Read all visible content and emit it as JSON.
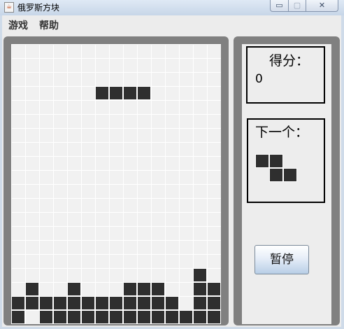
{
  "window": {
    "title": "俄罗斯方块",
    "minimize_glyph": "▭",
    "maximize_glyph": "▢",
    "close_glyph": "✕"
  },
  "menu": {
    "items": [
      "游戏",
      "帮助"
    ]
  },
  "score": {
    "label": "得分：",
    "value": "0"
  },
  "next": {
    "label": "下一个：",
    "piece": [
      [
        0,
        0
      ],
      [
        1,
        0
      ],
      [
        1,
        1
      ],
      [
        2,
        1
      ]
    ]
  },
  "controls": {
    "pause_label": "暂停"
  },
  "board": {
    "cols": 15,
    "rows": 20,
    "falling_piece": [
      [
        6,
        3
      ],
      [
        7,
        3
      ],
      [
        8,
        3
      ],
      [
        9,
        3
      ]
    ],
    "filled": [
      [
        13,
        16
      ],
      [
        1,
        17
      ],
      [
        4,
        17
      ],
      [
        8,
        17
      ],
      [
        9,
        17
      ],
      [
        10,
        17
      ],
      [
        13,
        17
      ],
      [
        14,
        17
      ],
      [
        0,
        18
      ],
      [
        1,
        18
      ],
      [
        2,
        18
      ],
      [
        3,
        18
      ],
      [
        4,
        18
      ],
      [
        5,
        18
      ],
      [
        6,
        18
      ],
      [
        7,
        18
      ],
      [
        8,
        18
      ],
      [
        9,
        18
      ],
      [
        10,
        18
      ],
      [
        11,
        18
      ],
      [
        13,
        18
      ],
      [
        14,
        18
      ],
      [
        0,
        19
      ],
      [
        2,
        19
      ],
      [
        3,
        19
      ],
      [
        4,
        19
      ],
      [
        5,
        19
      ],
      [
        6,
        19
      ],
      [
        7,
        19
      ],
      [
        8,
        19
      ],
      [
        9,
        19
      ],
      [
        10,
        19
      ],
      [
        11,
        19
      ],
      [
        12,
        19
      ],
      [
        13,
        19
      ],
      [
        14,
        19
      ]
    ]
  }
}
